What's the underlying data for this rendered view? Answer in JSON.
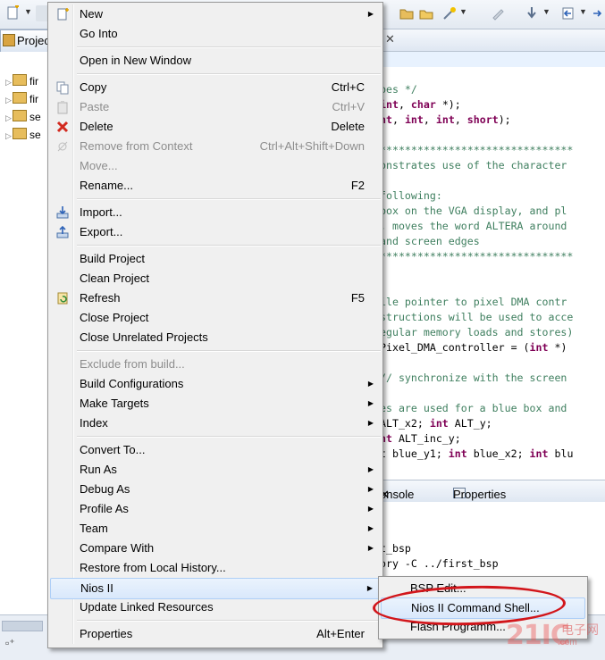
{
  "project_explorer": {
    "tab_label": "Projec",
    "items": [
      {
        "label": "fir"
      },
      {
        "label": "fir"
      },
      {
        "label": "se"
      },
      {
        "label": "se"
      }
    ]
  },
  "editor": {
    "lines": [
      {
        "segments": [
          {
            "t": "pes */",
            "c": "cm"
          }
        ]
      },
      {
        "segments": [
          {
            "t": "int",
            "c": "kw"
          },
          {
            "t": ", ",
            "c": "tx"
          },
          {
            "t": "char",
            "c": "kw"
          },
          {
            "t": " *);",
            "c": "tx"
          }
        ]
      },
      {
        "segments": [
          {
            "t": "nt",
            "c": "kw"
          },
          {
            "t": ", ",
            "c": "tx"
          },
          {
            "t": "int",
            "c": "kw"
          },
          {
            "t": ", ",
            "c": "tx"
          },
          {
            "t": "int",
            "c": "kw"
          },
          {
            "t": ", ",
            "c": "tx"
          },
          {
            "t": "short",
            "c": "kw"
          },
          {
            "t": ");",
            "c": "tx"
          }
        ]
      },
      {
        "segments": []
      },
      {
        "segments": [
          {
            "t": "*******************************",
            "c": "cm"
          }
        ]
      },
      {
        "segments": [
          {
            "t": "onstrates use of the character",
            "c": "cm"
          }
        ]
      },
      {
        "segments": []
      },
      {
        "segments": [
          {
            "t": "following:",
            "c": "cm"
          }
        ]
      },
      {
        "segments": [
          {
            "t": "box on the VGA display, and pl",
            "c": "cm"
          }
        ]
      },
      {
        "segments": [
          {
            "t": ", moves the word ALTERA around",
            "c": "cm"
          }
        ]
      },
      {
        "segments": [
          {
            "t": "and screen edges",
            "c": "cm"
          }
        ]
      },
      {
        "segments": [
          {
            "t": "*******************************",
            "c": "cm"
          }
        ]
      },
      {
        "segments": []
      },
      {
        "segments": []
      },
      {
        "segments": [
          {
            "t": "ile pointer to pixel DMA contr",
            "c": "cm"
          }
        ]
      },
      {
        "segments": [
          {
            "t": "structions will be used to acce",
            "c": "cm"
          }
        ]
      },
      {
        "segments": [
          {
            "t": "egular memory loads and stores)",
            "c": "cm"
          }
        ]
      },
      {
        "segments": [
          {
            "t": "Pixel_DMA_controller = (",
            "c": "tx"
          },
          {
            "t": "int",
            "c": "kw"
          },
          {
            "t": " *)",
            "c": "tx"
          }
        ]
      },
      {
        "segments": []
      },
      {
        "segments": [
          {
            "t": "// synchronize with the screen",
            "c": "cm"
          }
        ]
      },
      {
        "segments": []
      },
      {
        "segments": [
          {
            "t": "es are used for a blue box and",
            "c": "cm"
          }
        ]
      },
      {
        "segments": [
          {
            "t": "ALT_x2; ",
            "c": "tx"
          },
          {
            "t": "int",
            "c": "kw"
          },
          {
            "t": " ALT_y;",
            "c": "tx"
          }
        ]
      },
      {
        "segments": [
          {
            "t": "nt",
            "c": "kw"
          },
          {
            "t": " ALT_inc_y;",
            "c": "tx"
          }
        ]
      },
      {
        "segments": [
          {
            "t": "t blue_y1; ",
            "c": "tx"
          },
          {
            "t": "int",
            "c": "kw"
          },
          {
            "t": " blue_x2; ",
            "c": "tx"
          },
          {
            "t": "int",
            "c": "kw"
          },
          {
            "t": " blu",
            "c": "tx"
          }
        ]
      }
    ]
  },
  "console": {
    "tab_console": "onsole",
    "tab_properties": "Properties",
    "lines": [
      "t_bsp",
      "ory -C ../first_bsp"
    ]
  },
  "context_menu": {
    "items": [
      {
        "label": "New",
        "shortcut": "",
        "submenu": true,
        "disabled": false,
        "icon": "new-icon",
        "hot": false
      },
      {
        "label": "Go Into",
        "shortcut": "",
        "submenu": false,
        "disabled": false,
        "icon": "",
        "hot": false
      },
      {
        "sep": true
      },
      {
        "label": "Open in New Window",
        "shortcut": "",
        "submenu": false,
        "disabled": false,
        "icon": "",
        "hot": false
      },
      {
        "sep": true
      },
      {
        "label": "Copy",
        "shortcut": "Ctrl+C",
        "submenu": false,
        "disabled": false,
        "icon": "copy-icon",
        "hot": false
      },
      {
        "label": "Paste",
        "shortcut": "Ctrl+V",
        "submenu": false,
        "disabled": true,
        "icon": "paste-icon",
        "hot": false
      },
      {
        "label": "Delete",
        "shortcut": "Delete",
        "submenu": false,
        "disabled": false,
        "icon": "delete-icon",
        "hot": false
      },
      {
        "label": "Remove from Context",
        "shortcut": "Ctrl+Alt+Shift+Down",
        "submenu": false,
        "disabled": true,
        "icon": "remove-context-icon",
        "hot": false
      },
      {
        "label": "Move...",
        "shortcut": "",
        "submenu": false,
        "disabled": true,
        "icon": "",
        "hot": false
      },
      {
        "label": "Rename...",
        "shortcut": "F2",
        "submenu": false,
        "disabled": false,
        "icon": "",
        "hot": false
      },
      {
        "sep": true
      },
      {
        "label": "Import...",
        "shortcut": "",
        "submenu": false,
        "disabled": false,
        "icon": "import-icon",
        "hot": false
      },
      {
        "label": "Export...",
        "shortcut": "",
        "submenu": false,
        "disabled": false,
        "icon": "export-icon",
        "hot": false
      },
      {
        "sep": true
      },
      {
        "label": "Build Project",
        "shortcut": "",
        "submenu": false,
        "disabled": false,
        "icon": "",
        "hot": false
      },
      {
        "label": "Clean Project",
        "shortcut": "",
        "submenu": false,
        "disabled": false,
        "icon": "",
        "hot": false
      },
      {
        "label": "Refresh",
        "shortcut": "F5",
        "submenu": false,
        "disabled": false,
        "icon": "refresh-icon",
        "hot": false
      },
      {
        "label": "Close Project",
        "shortcut": "",
        "submenu": false,
        "disabled": false,
        "icon": "",
        "hot": false
      },
      {
        "label": "Close Unrelated Projects",
        "shortcut": "",
        "submenu": false,
        "disabled": false,
        "icon": "",
        "hot": false
      },
      {
        "sep": true
      },
      {
        "label": "Exclude from build...",
        "shortcut": "",
        "submenu": false,
        "disabled": true,
        "icon": "",
        "hot": false
      },
      {
        "label": "Build Configurations",
        "shortcut": "",
        "submenu": true,
        "disabled": false,
        "icon": "",
        "hot": false
      },
      {
        "label": "Make Targets",
        "shortcut": "",
        "submenu": true,
        "disabled": false,
        "icon": "",
        "hot": false
      },
      {
        "label": "Index",
        "shortcut": "",
        "submenu": true,
        "disabled": false,
        "icon": "",
        "hot": false
      },
      {
        "sep": true
      },
      {
        "label": "Convert To...",
        "shortcut": "",
        "submenu": false,
        "disabled": false,
        "icon": "",
        "hot": false
      },
      {
        "label": "Run As",
        "shortcut": "",
        "submenu": true,
        "disabled": false,
        "icon": "",
        "hot": false
      },
      {
        "label": "Debug As",
        "shortcut": "",
        "submenu": true,
        "disabled": false,
        "icon": "",
        "hot": false
      },
      {
        "label": "Profile As",
        "shortcut": "",
        "submenu": true,
        "disabled": false,
        "icon": "",
        "hot": false
      },
      {
        "label": "Team",
        "shortcut": "",
        "submenu": true,
        "disabled": false,
        "icon": "",
        "hot": false
      },
      {
        "label": "Compare With",
        "shortcut": "",
        "submenu": true,
        "disabled": false,
        "icon": "",
        "hot": false
      },
      {
        "label": "Restore from Local History...",
        "shortcut": "",
        "submenu": false,
        "disabled": false,
        "icon": "",
        "hot": false
      },
      {
        "label": "Nios II",
        "shortcut": "",
        "submenu": true,
        "disabled": false,
        "icon": "",
        "hot": true
      },
      {
        "label": "Update Linked Resources",
        "shortcut": "",
        "submenu": false,
        "disabled": false,
        "icon": "",
        "hot": false
      },
      {
        "sep": true
      },
      {
        "label": "Properties",
        "shortcut": "Alt+Enter",
        "submenu": false,
        "disabled": false,
        "icon": "",
        "hot": false
      }
    ]
  },
  "nios_submenu": {
    "items": [
      {
        "label": "BSP Edit...",
        "hot": false
      },
      {
        "label": "Nios II Command Shell...",
        "hot": true
      },
      {
        "label": "Flash Programm...",
        "hot": false
      }
    ]
  },
  "watermark": {
    "big": "21IC",
    "cn": "电子网",
    "com": ".com"
  },
  "colors": {
    "highlight_ring": "#d2161b",
    "menu_bg": "#f0f0f0",
    "hover_bg": "#d9e8fb",
    "comment": "#3f7f5f",
    "keyword": "#7f0055"
  }
}
